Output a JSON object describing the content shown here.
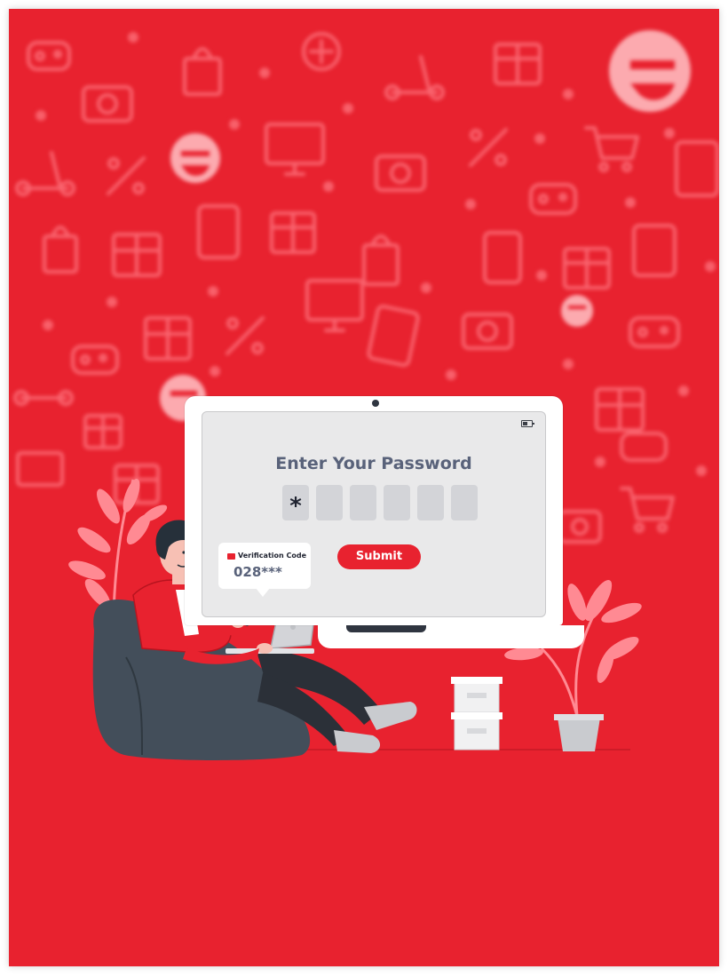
{
  "login_screen": {
    "title": "Enter Your Password",
    "password_boxes": [
      "*",
      "",
      "",
      "",
      "",
      ""
    ],
    "submit_label": "Submit"
  },
  "verification_popup": {
    "label": "Verification Code",
    "code": "028***"
  },
  "colors": {
    "brand_red": "#e8222f",
    "title_slate": "#59627a",
    "screen_gray": "#e9e9ea",
    "code_box_gray": "#d3d4d8",
    "beanbag": "#434e5a"
  },
  "icons": [
    "gamepad-icon",
    "shopping-bag-icon",
    "camera-icon",
    "percent-icon",
    "scooter-icon",
    "shopping-cart-icon",
    "gift-icon",
    "tablet-icon",
    "monitor-icon",
    "brand-e-logo",
    "battery-icon",
    "mail-icon"
  ]
}
